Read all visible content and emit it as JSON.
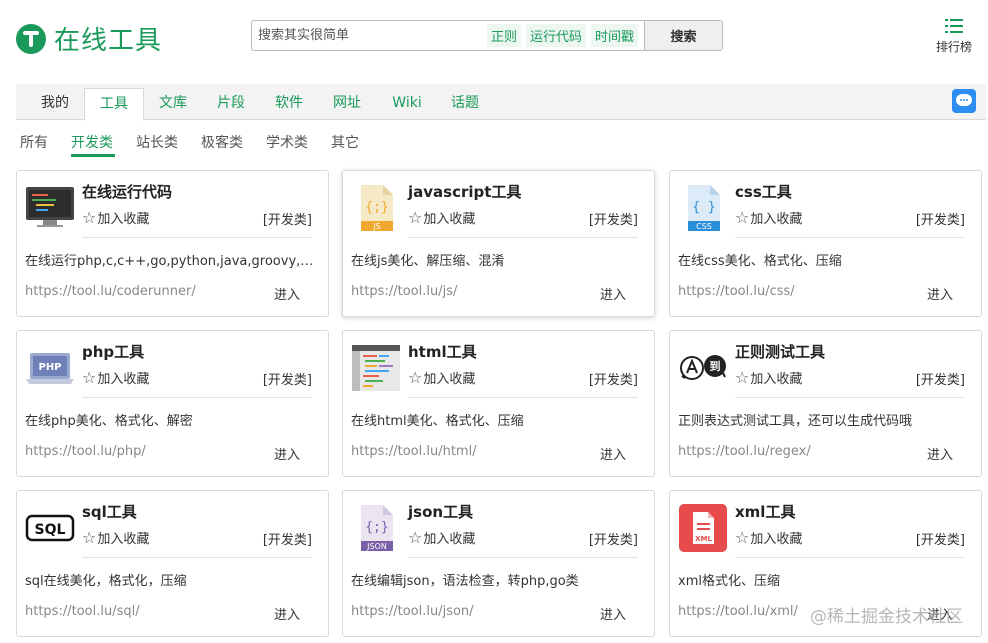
{
  "logo": {
    "title": "在线工具"
  },
  "search": {
    "placeholder": "搜索其实很简单",
    "tags": [
      "正则",
      "运行代码",
      "时间戳"
    ],
    "button": "搜索"
  },
  "rank": {
    "label": "排行榜"
  },
  "tabs": [
    {
      "label": "我的"
    },
    {
      "label": "工具"
    },
    {
      "label": "文库"
    },
    {
      "label": "片段"
    },
    {
      "label": "软件"
    },
    {
      "label": "网址"
    },
    {
      "label": "Wiki"
    },
    {
      "label": "话题"
    }
  ],
  "subcategories": [
    {
      "label": "所有"
    },
    {
      "label": "开发类"
    },
    {
      "label": "站长类"
    },
    {
      "label": "极客类"
    },
    {
      "label": "学术类"
    },
    {
      "label": "其它"
    }
  ],
  "cards": [
    {
      "title": "在线运行代码",
      "favorite": "加入收藏",
      "category": "[开发类]",
      "description": "在线运行php,c,c++,go,python,java,groovy,ruby,rust...",
      "url": "https://tool.lu/coderunner/",
      "enter": "进入",
      "icon": "code-runner-icon"
    },
    {
      "title": "javascript工具",
      "favorite": "加入收藏",
      "category": "[开发类]",
      "description": "在线js美化、解压缩、混淆",
      "url": "https://tool.lu/js/",
      "enter": "进入",
      "icon": "js-file-icon"
    },
    {
      "title": "css工具",
      "favorite": "加入收藏",
      "category": "[开发类]",
      "description": "在线css美化、格式化、压缩",
      "url": "https://tool.lu/css/",
      "enter": "进入",
      "icon": "css-file-icon"
    },
    {
      "title": "php工具",
      "favorite": "加入收藏",
      "category": "[开发类]",
      "description": "在线php美化、格式化、解密",
      "url": "https://tool.lu/php/",
      "enter": "进入",
      "icon": "php-laptop-icon"
    },
    {
      "title": "html工具",
      "favorite": "加入收藏",
      "category": "[开发类]",
      "description": "在线html美化、格式化、压缩",
      "url": "https://tool.lu/html/",
      "enter": "进入",
      "icon": "html-editor-icon"
    },
    {
      "title": "正则测试工具",
      "favorite": "加入收藏",
      "category": "[开发类]",
      "description": "正则表达式测试工具，还可以生成代码哦",
      "url": "https://tool.lu/regex/",
      "enter": "进入",
      "icon": "regex-icon"
    },
    {
      "title": "sql工具",
      "favorite": "加入收藏",
      "category": "[开发类]",
      "description": "sql在线美化，格式化，压缩",
      "url": "https://tool.lu/sql/",
      "enter": "进入",
      "icon": "sql-icon"
    },
    {
      "title": "json工具",
      "favorite": "加入收藏",
      "category": "[开发类]",
      "description": "在线编辑json，语法检查，转php,go类",
      "url": "https://tool.lu/json/",
      "enter": "进入",
      "icon": "json-file-icon"
    },
    {
      "title": "xml工具",
      "favorite": "加入收藏",
      "category": "[开发类]",
      "description": "xml格式化、压缩",
      "url": "https://tool.lu/xml/",
      "enter": "进入",
      "icon": "xml-file-icon"
    }
  ],
  "watermark": "@稀土掘金技术社区",
  "colors": {
    "brand": "#1a9a5a",
    "chat": "#2b8ef0",
    "xml": "#e84b4b",
    "js": "#f0a830",
    "css": "#2a8fd8",
    "json": "#7a5fa8"
  }
}
